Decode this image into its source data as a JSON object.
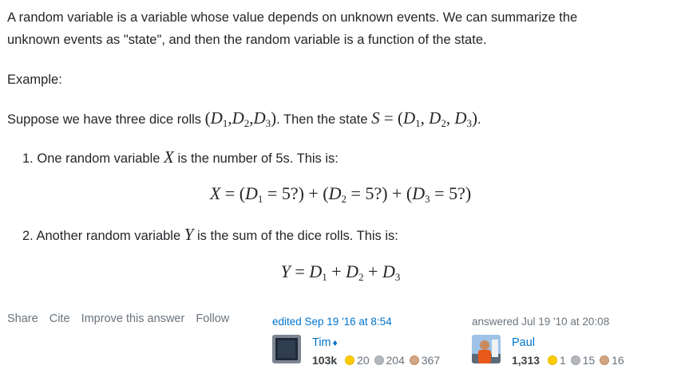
{
  "intro": {
    "line1": "A random variable is a variable whose value depends on unknown events. We can summarize the",
    "line2": "unknown events as \"state\", and then the random variable is a function of the state."
  },
  "example_label": "Example:",
  "suppose": {
    "text_before": "Suppose we have three dice rolls ",
    "text_middle": ". Then the state ",
    "text_end": "."
  },
  "list": [
    {
      "num": "1.",
      "before": "One random variable ",
      "var": "X",
      "after": " is the number of 5s. This is:"
    },
    {
      "num": "2.",
      "before": "Another random variable ",
      "var": "Y",
      "after": " is the sum of the dice rolls. This is:"
    }
  ],
  "post_menu": [
    "Share",
    "Cite",
    "Improve this answer",
    "Follow"
  ],
  "editor": {
    "action": "edited Sep 19 '16 at 8:54",
    "name": "Tim",
    "moderator_mark": "♦",
    "reputation": "103k",
    "gold": "20",
    "silver": "204",
    "bronze": "367"
  },
  "author": {
    "action": "answered Jul 19 '10 at 20:08",
    "name": "Paul",
    "reputation": "1,313",
    "gold": "1",
    "silver": "15",
    "bronze": "16"
  },
  "colors": {
    "link": "#0074cc",
    "muted": "#6a737c",
    "text": "#232629"
  }
}
